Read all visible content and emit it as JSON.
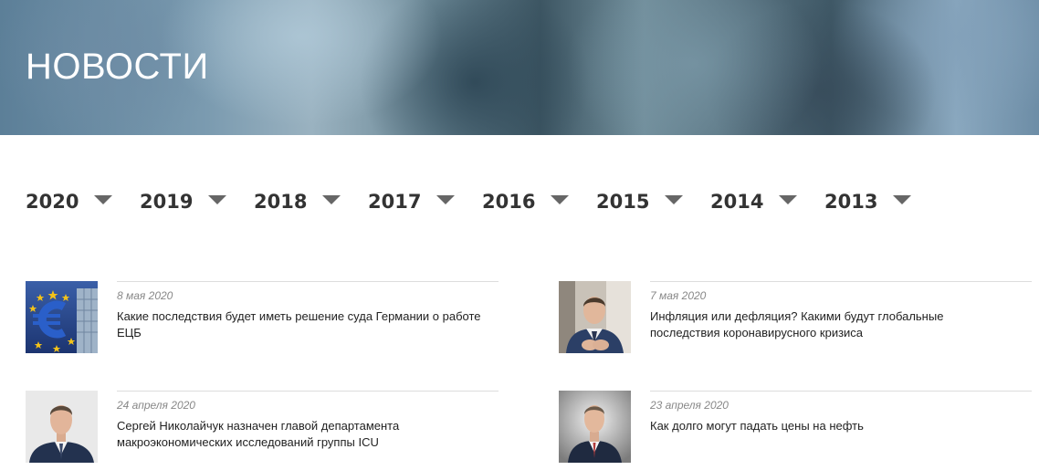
{
  "hero": {
    "title": "НОВОСТИ"
  },
  "years": [
    {
      "label": "2020"
    },
    {
      "label": "2019"
    },
    {
      "label": "2018"
    },
    {
      "label": "2017"
    },
    {
      "label": "2016"
    },
    {
      "label": "2015"
    },
    {
      "label": "2014"
    },
    {
      "label": "2013"
    }
  ],
  "news": [
    {
      "date": "8 мая 2020",
      "title": "Какие последствия будет иметь решение суда Германии о работе ЕЦБ",
      "thumb": "euro-sign-photo"
    },
    {
      "date": "7 мая 2020",
      "title": "Инфляция или дефляция? Какими будут глобальные последствия коронавирусного кризиса",
      "thumb": "man-portrait-photo"
    },
    {
      "date": "24 апреля 2020",
      "title": "Сергей Николайчук назначен главой департамента макроэкономических исследований группы ICU",
      "thumb": "man-portrait-photo"
    },
    {
      "date": "23 апреля 2020",
      "title": "Как долго могут падать цены на нефть",
      "thumb": "man-portrait-photo"
    }
  ]
}
